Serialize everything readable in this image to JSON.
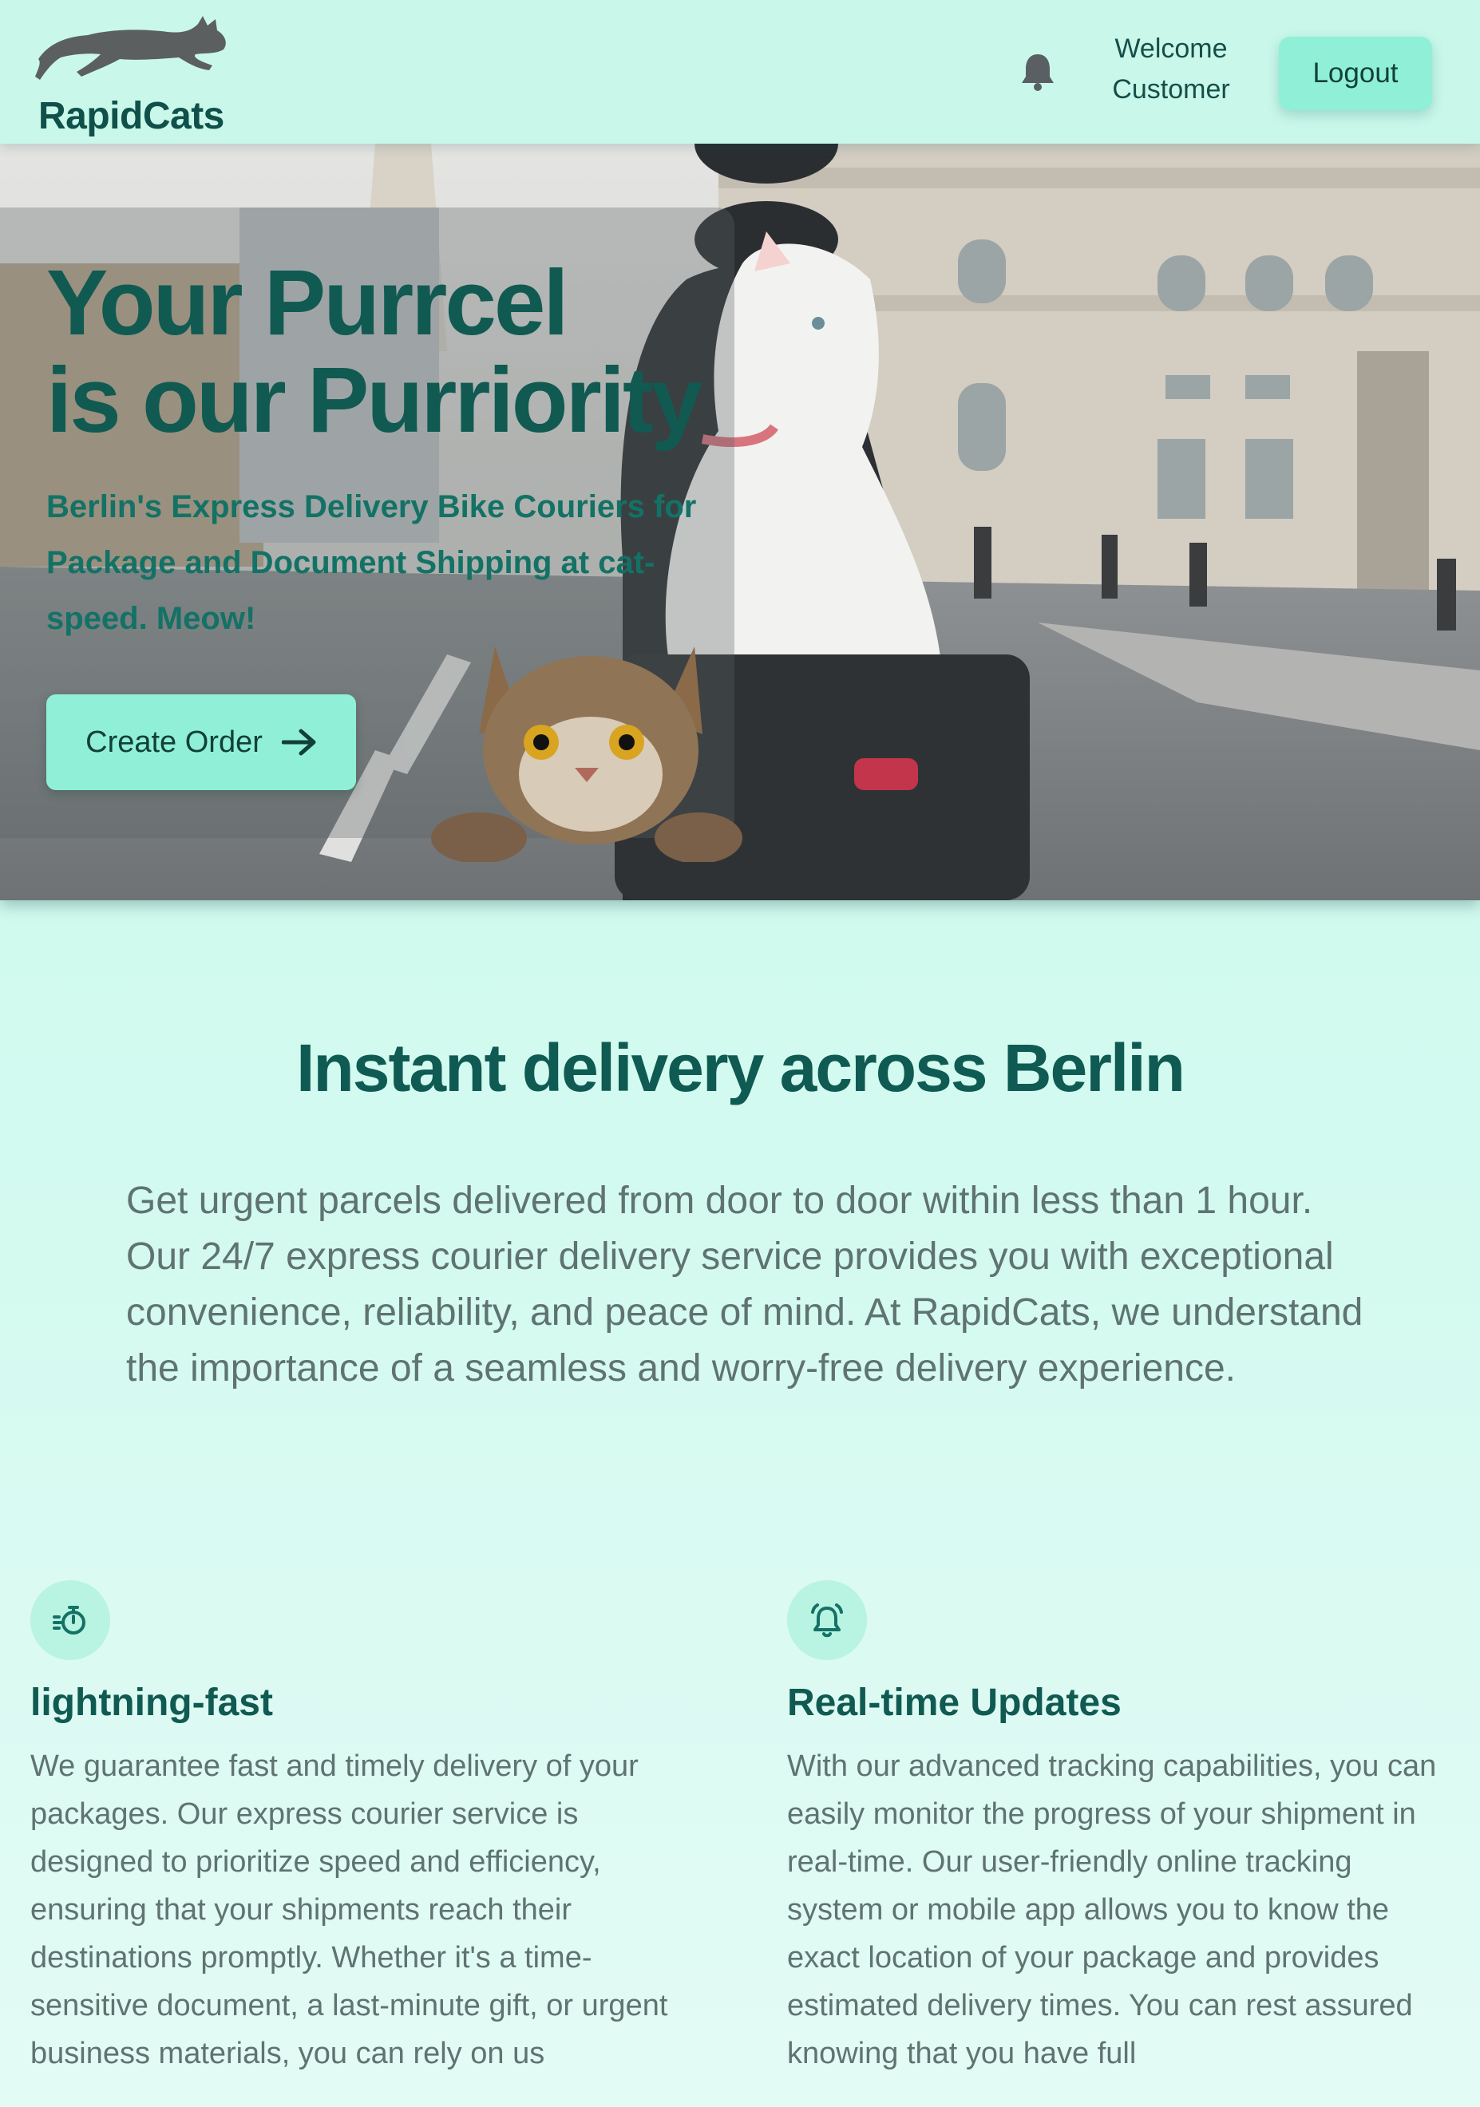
{
  "header": {
    "brand": "RapidCats",
    "welcome_line1": "Welcome",
    "welcome_line2": "Customer",
    "logout_label": "Logout",
    "notification_icon": "bell-icon"
  },
  "hero": {
    "title_line1": "Your Purrcel",
    "title_line2": "is our Purriority",
    "subtitle": "Berlin's Express Delivery Bike Couriers for Package and Document Shipping at cat-speed. Meow!",
    "cta_label": "Create Order",
    "cta_icon": "arrow-right-icon"
  },
  "intro": {
    "title": "Instant delivery across Berlin",
    "body": "Get urgent parcels delivered from door to door within less than 1 hour. Our 24/7 express courier delivery service provides you with exceptional convenience, reliability, and peace of mind. At RapidCats, we understand the importance of a seamless and worry-free delivery experience."
  },
  "features": [
    {
      "icon": "stopwatch-icon",
      "title": "lightning-fast",
      "body": "We guarantee fast and timely delivery of your packages. Our express courier service is designed to prioritize speed and efficiency, ensuring that your shipments reach their destinations promptly. Whether it's a time-sensitive document, a last-minute gift, or urgent business materials, you can rely on us"
    },
    {
      "icon": "alarm-bell-icon",
      "title": "Real-time Updates",
      "body": "With our advanced tracking capabilities, you can easily monitor the progress of your shipment in real-time. Our user-friendly online tracking system or mobile app allows you to know the exact location of your package and provides estimated delivery times. You can rest assured knowing that you have full"
    }
  ],
  "colors": {
    "accent": "#8ff0d7",
    "brand_text": "#0f5a52",
    "background": "#c8f9ec",
    "body_text": "#5f7370"
  }
}
